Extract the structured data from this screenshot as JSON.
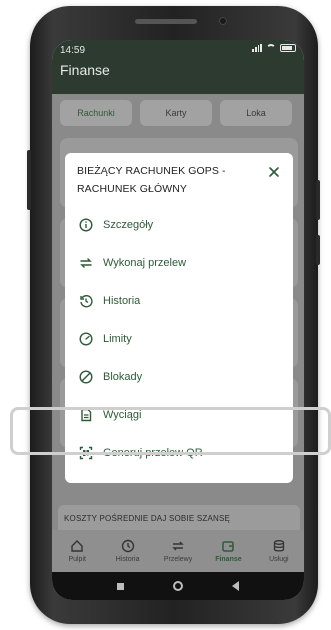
{
  "status_bar": {
    "time": "14:59"
  },
  "header": {
    "title": "Finanse"
  },
  "tabs": [
    {
      "label": "Rachunki",
      "active": true
    },
    {
      "label": "Karty",
      "active": false
    },
    {
      "label": "Loka",
      "active": false
    }
  ],
  "modal": {
    "title": "BIEŻĄCY RACHUNEK GOPS - RACHUNEK GŁÓWNY",
    "close_icon": "close-icon",
    "items": [
      {
        "label": "Szczegóły",
        "icon": "info-icon"
      },
      {
        "label": "Wykonaj przelew",
        "icon": "transfer-icon"
      },
      {
        "label": "Historia",
        "icon": "history-icon"
      },
      {
        "label": "Limity",
        "icon": "limits-icon"
      },
      {
        "label": "Blokady",
        "icon": "block-icon"
      },
      {
        "label": "Wyciągi",
        "icon": "document-icon"
      },
      {
        "label": "Generuj przelew QR",
        "icon": "qr-scan-icon"
      }
    ]
  },
  "background": {
    "bottom_card_text": "KOSZTY POŚREDNIE DAJ SOBIE SZANSĘ"
  },
  "bottom_nav": [
    {
      "label": "Pulpit",
      "icon": "home-icon",
      "active": false
    },
    {
      "label": "Historia",
      "icon": "history-icon",
      "active": false
    },
    {
      "label": "Przelewy",
      "icon": "transfer-icon",
      "active": false
    },
    {
      "label": "Finanse",
      "icon": "wallet-icon",
      "active": true
    },
    {
      "label": "Usługi",
      "icon": "database-icon",
      "active": false
    }
  ],
  "colors": {
    "accent": "#2e5a38",
    "highlight_frame": "#cfcfcf",
    "overlay": "#8a8a8a"
  }
}
